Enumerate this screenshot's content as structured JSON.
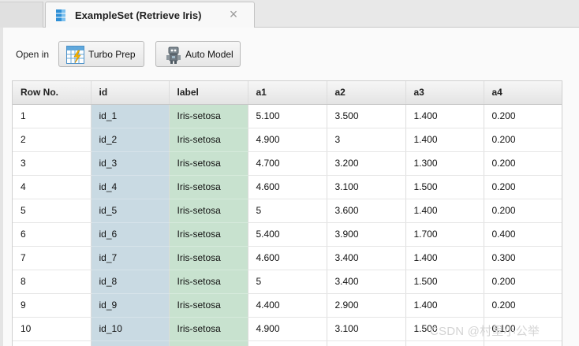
{
  "tab": {
    "title": "ExampleSet (Retrieve Iris)",
    "close_label": "×",
    "icon": "exampleset-icon"
  },
  "toolbar": {
    "open_in_label": "Open in",
    "turbo_prep_label": "Turbo Prep",
    "auto_model_label": "Auto Model"
  },
  "table": {
    "columns": [
      "Row No.",
      "id",
      "label",
      "a1",
      "a2",
      "a3",
      "a4"
    ],
    "rows": [
      [
        "1",
        "id_1",
        "Iris-setosa",
        "5.100",
        "3.500",
        "1.400",
        "0.200"
      ],
      [
        "2",
        "id_2",
        "Iris-setosa",
        "4.900",
        "3",
        "1.400",
        "0.200"
      ],
      [
        "3",
        "id_3",
        "Iris-setosa",
        "4.700",
        "3.200",
        "1.300",
        "0.200"
      ],
      [
        "4",
        "id_4",
        "Iris-setosa",
        "4.600",
        "3.100",
        "1.500",
        "0.200"
      ],
      [
        "5",
        "id_5",
        "Iris-setosa",
        "5",
        "3.600",
        "1.400",
        "0.200"
      ],
      [
        "6",
        "id_6",
        "Iris-setosa",
        "5.400",
        "3.900",
        "1.700",
        "0.400"
      ],
      [
        "7",
        "id_7",
        "Iris-setosa",
        "4.600",
        "3.400",
        "1.400",
        "0.300"
      ],
      [
        "8",
        "id_8",
        "Iris-setosa",
        "5",
        "3.400",
        "1.500",
        "0.200"
      ],
      [
        "9",
        "id_9",
        "Iris-setosa",
        "4.400",
        "2.900",
        "1.400",
        "0.200"
      ],
      [
        "10",
        "id_10",
        "Iris-setosa",
        "4.900",
        "3.100",
        "1.500",
        "0.100"
      ]
    ]
  },
  "watermark": "CSDN @村里小公举",
  "colors": {
    "id_column": "#c9dae3",
    "label_column": "#c8e2cf",
    "tab_icon": "#2e8fd6"
  }
}
